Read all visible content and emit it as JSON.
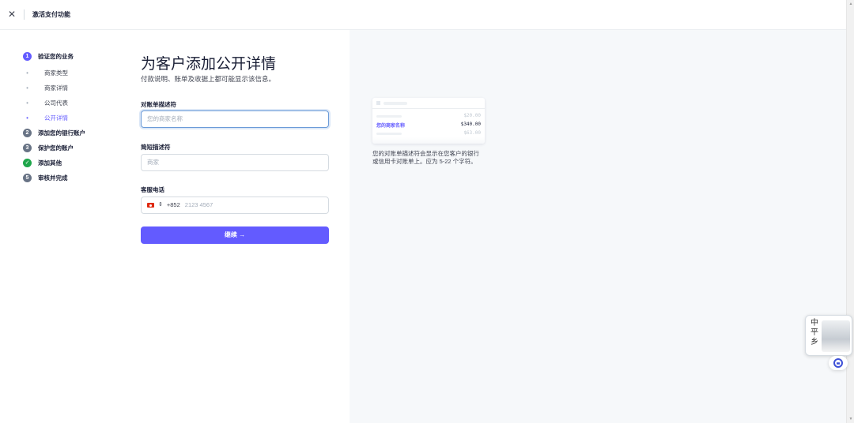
{
  "topbar": {
    "close_icon": "✕",
    "title": "激活支付功能"
  },
  "steps": [
    {
      "number": "1",
      "label": "验证您的业务",
      "state": "active"
    },
    {
      "label": "商家类型",
      "state": "sub"
    },
    {
      "label": "商家详情",
      "state": "sub"
    },
    {
      "label": "公司代表",
      "state": "sub"
    },
    {
      "label": "公开详情",
      "state": "sub-active"
    },
    {
      "number": "2",
      "label": "添加您的银行账户",
      "state": "pending"
    },
    {
      "number": "3",
      "label": "保护您的账户",
      "state": "pending"
    },
    {
      "number": "✓",
      "label": "添加其他",
      "state": "done"
    },
    {
      "number": "5",
      "label": "审核并完成",
      "state": "pending"
    }
  ],
  "form": {
    "title": "为客户添加公开详情",
    "subtitle": "付款说明、账单及收据上都可能显示该信息。",
    "statement_descriptor": {
      "label": "对账单描述符",
      "placeholder": "您的商家名称"
    },
    "short_descriptor": {
      "label": "简短描述符",
      "placeholder": "商家"
    },
    "support_phone": {
      "label": "客服电话",
      "country_code": "+852",
      "placeholder": "2123 4567",
      "chevron": "⇕"
    },
    "continue_label": "继续 →"
  },
  "preview": {
    "rows": [
      {
        "merchant": "",
        "amount": "$20.00"
      },
      {
        "merchant": "您的商家名称",
        "amount": "$340.00"
      },
      {
        "merchant": "",
        "amount": "$63.00"
      }
    ],
    "description": "您的对账单描述符会显示在您客户的银行或信用卡对账单上。应为 5-22 个字符。"
  },
  "widget": {
    "chars": "中\n平\n乡"
  },
  "colors": {
    "accent": "#635bff",
    "success": "#1ea64a",
    "panel_bg": "#f6f8fa"
  }
}
